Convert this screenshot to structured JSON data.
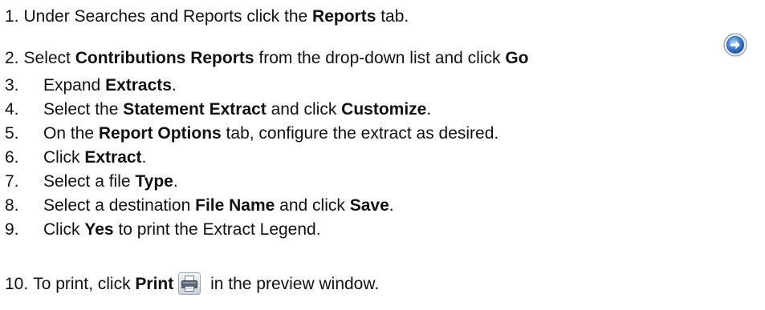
{
  "steps": [
    {
      "num": "1.",
      "parts": [
        "Under Searches and Reports click the ",
        "Reports",
        " tab."
      ]
    },
    {
      "num": "2.",
      "parts": [
        "Select ",
        "Contributions Reports",
        " from the drop-down list and click ",
        "Go"
      ]
    },
    {
      "num": "3.",
      "parts": [
        "Expand ",
        "Extracts",
        "."
      ]
    },
    {
      "num": "4.",
      "parts": [
        "Select the ",
        "Statement Extract",
        " and click ",
        "Customize",
        "."
      ]
    },
    {
      "num": "5.",
      "parts": [
        "On the ",
        "Report Options",
        " tab, configure the extract as desired."
      ]
    },
    {
      "num": "6.",
      "parts": [
        "Click ",
        "Extract",
        "."
      ]
    },
    {
      "num": "7.",
      "parts": [
        "Select a file ",
        "Type",
        "."
      ]
    },
    {
      "num": "8.",
      "parts": [
        "Select a destination ",
        "File Name",
        " and click ",
        "Save",
        "."
      ]
    },
    {
      "num": "9.",
      "parts": [
        "Click ",
        "Yes",
        " to print the Extract Legend."
      ]
    },
    {
      "num": "10.",
      "parts": [
        "To print, click ",
        "Print",
        " in the preview window."
      ]
    }
  ],
  "icons": {
    "go": "go-arrow-icon",
    "print": "printer-icon",
    "go_color": "#3a78c8"
  }
}
